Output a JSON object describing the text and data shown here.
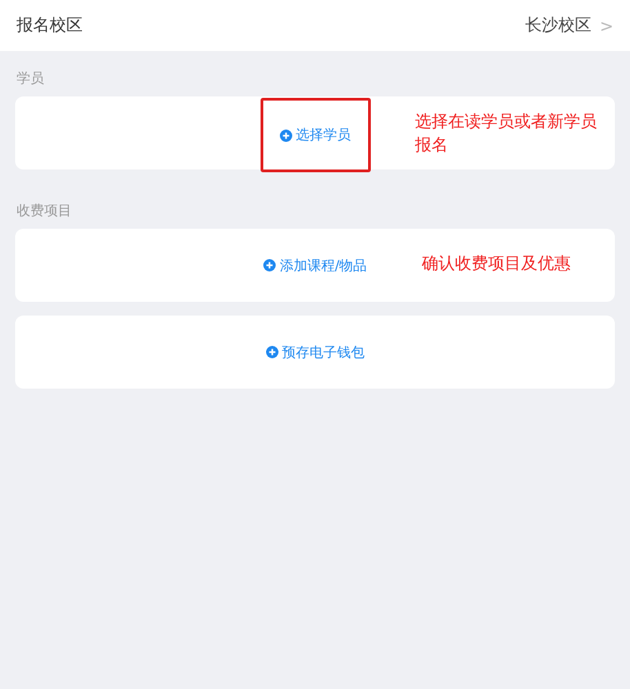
{
  "header": {
    "label": "报名校区",
    "value": "长沙校区",
    "chevron": ">"
  },
  "sections": [
    {
      "title": "学员",
      "cards": [
        {
          "action": "选择学员",
          "highlighted": true,
          "note": "选择在读学员或者新学员报名"
        }
      ]
    },
    {
      "title": "收费项目",
      "cards": [
        {
          "action": "添加课程/物品",
          "highlighted": false,
          "note": "确认收费项目及优惠"
        },
        {
          "action": "预存电子钱包",
          "highlighted": false
        }
      ]
    }
  ]
}
